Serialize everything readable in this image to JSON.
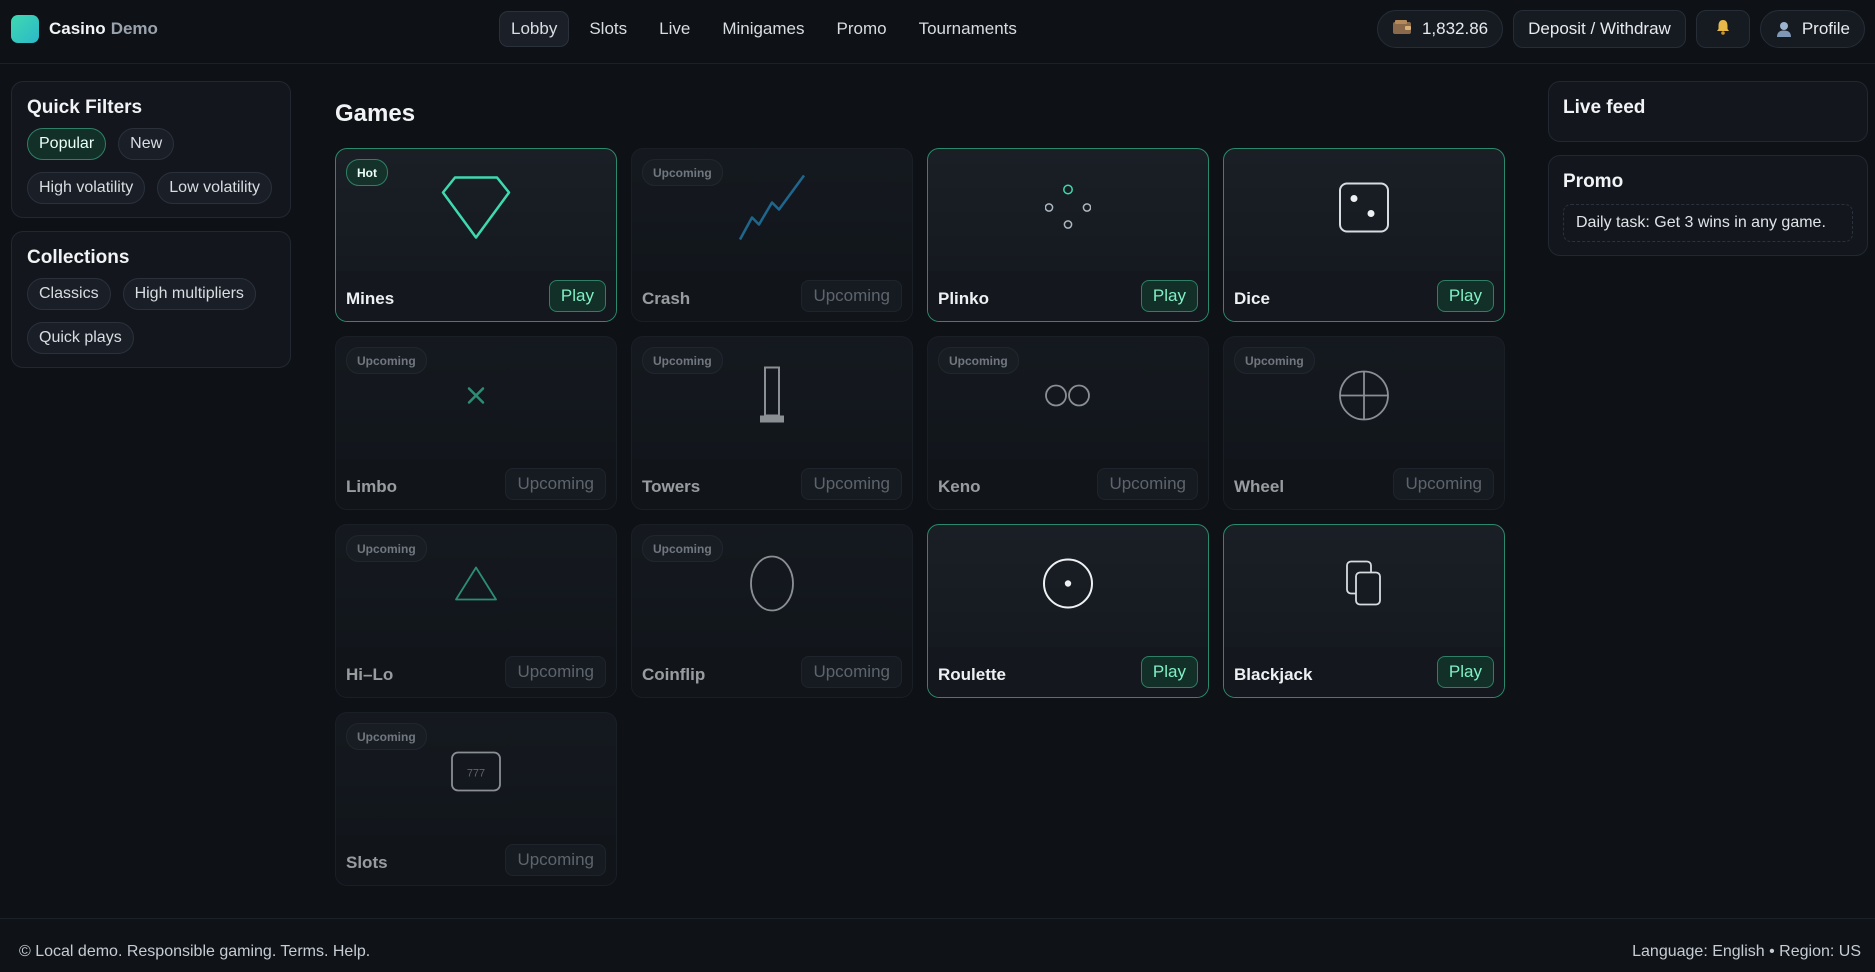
{
  "brand": {
    "name": "Casino",
    "sub": "Demo"
  },
  "nav": [
    {
      "label": "Lobby",
      "active": true
    },
    {
      "label": "Slots"
    },
    {
      "label": "Live"
    },
    {
      "label": "Minigames"
    },
    {
      "label": "Promo"
    },
    {
      "label": "Tournaments"
    }
  ],
  "header": {
    "balance": "1,832.86",
    "deposit_label": "Deposit / Withdraw",
    "profile_label": "Profile"
  },
  "icons": {
    "wallet": "wallet-icon",
    "bell": "bell-icon",
    "profile": "user-icon"
  },
  "quick_filters": {
    "title": "Quick Filters",
    "items": [
      "Popular",
      "New",
      "High volatility",
      "Low volatility"
    ]
  },
  "collections": {
    "title": "Collections",
    "items": [
      "Classics",
      "High multipliers",
      "Quick plays"
    ]
  },
  "games": {
    "title": "Games",
    "items": [
      {
        "name": "Mines",
        "badge": "Hot",
        "action": "Play",
        "status": "available",
        "icon": "diamond-icon"
      },
      {
        "name": "Crash",
        "badge": "Upcoming",
        "action": "Upcoming",
        "status": "upcoming",
        "icon": "chart-line-icon"
      },
      {
        "name": "Plinko",
        "badge": "",
        "action": "Play",
        "status": "available",
        "icon": "plinko-pegs-icon"
      },
      {
        "name": "Dice",
        "badge": "",
        "action": "Play",
        "status": "available",
        "icon": "dice-icon"
      },
      {
        "name": "Limbo",
        "badge": "Upcoming",
        "action": "Upcoming",
        "status": "upcoming",
        "icon": "multiply-icon"
      },
      {
        "name": "Towers",
        "badge": "Upcoming",
        "action": "Upcoming",
        "status": "upcoming",
        "icon": "tower-icon"
      },
      {
        "name": "Keno",
        "badge": "Upcoming",
        "action": "Upcoming",
        "status": "upcoming",
        "icon": "keno-balls-icon"
      },
      {
        "name": "Wheel",
        "badge": "Upcoming",
        "action": "Upcoming",
        "status": "upcoming",
        "icon": "wheel-icon"
      },
      {
        "name": "Hi–Lo",
        "badge": "Upcoming",
        "action": "Upcoming",
        "status": "upcoming",
        "icon": "triangle-icon"
      },
      {
        "name": "Coinflip",
        "badge": "Upcoming",
        "action": "Upcoming",
        "status": "upcoming",
        "icon": "coin-icon"
      },
      {
        "name": "Roulette",
        "badge": "",
        "action": "Play",
        "status": "available",
        "icon": "roulette-icon"
      },
      {
        "name": "Blackjack",
        "badge": "",
        "action": "Play",
        "status": "available",
        "icon": "cards-icon"
      },
      {
        "name": "Slots",
        "badge": "Upcoming",
        "action": "Upcoming",
        "status": "upcoming",
        "icon": "slot-machine-icon",
        "art_text": "777"
      }
    ]
  },
  "live_feed": {
    "title": "Live feed"
  },
  "promo": {
    "title": "Promo",
    "task": "Daily task: Get 3 wins in any game."
  },
  "footer": {
    "left": "© Local demo. Responsible gaming. Terms. Help.",
    "right": "Language: English • Region: US"
  },
  "colors": {
    "background": "#0e1116",
    "accent": "#3fd9b0",
    "play_text": "#7ff0c6",
    "available_border": "#2b8a6b"
  }
}
